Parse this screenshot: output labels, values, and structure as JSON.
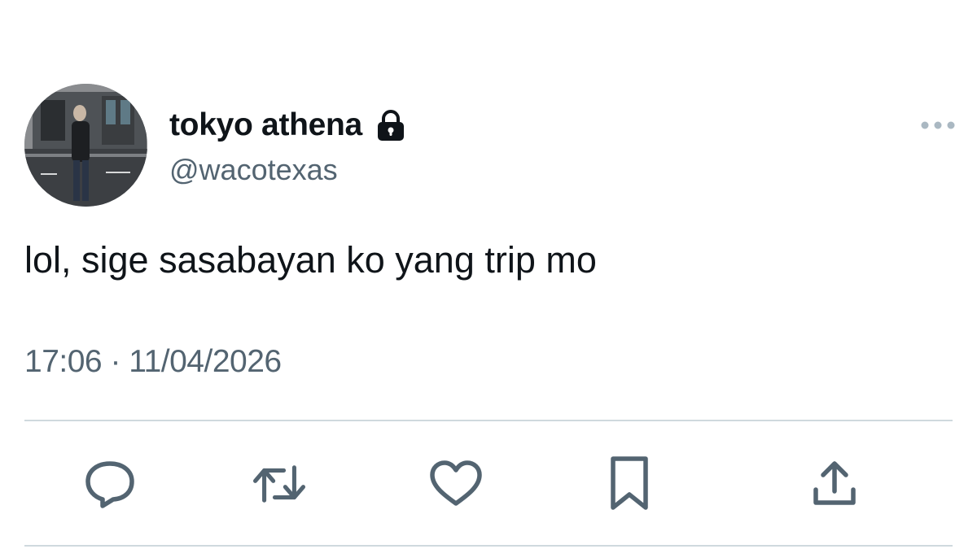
{
  "tweet": {
    "author": {
      "display_name": "tokyo athena",
      "handle": "@wacotexas",
      "protected_icon": "lock-icon",
      "avatar": "profile-photo"
    },
    "text": "lol, sige sasabayan ko yang trip mo",
    "time": "17:06",
    "separator": "·",
    "date": "11/04/2026"
  },
  "actions": [
    {
      "name": "reply",
      "icon": "reply-icon"
    },
    {
      "name": "retweet",
      "icon": "retweet-icon"
    },
    {
      "name": "like",
      "icon": "heart-icon"
    },
    {
      "name": "bookmark",
      "icon": "bookmark-icon"
    },
    {
      "name": "share",
      "icon": "share-icon"
    }
  ],
  "menu": {
    "icon": "more-icon"
  },
  "colors": {
    "text_primary": "#0f1419",
    "text_secondary": "#536471",
    "divider": "#cfd9de",
    "background": "#ffffff"
  }
}
